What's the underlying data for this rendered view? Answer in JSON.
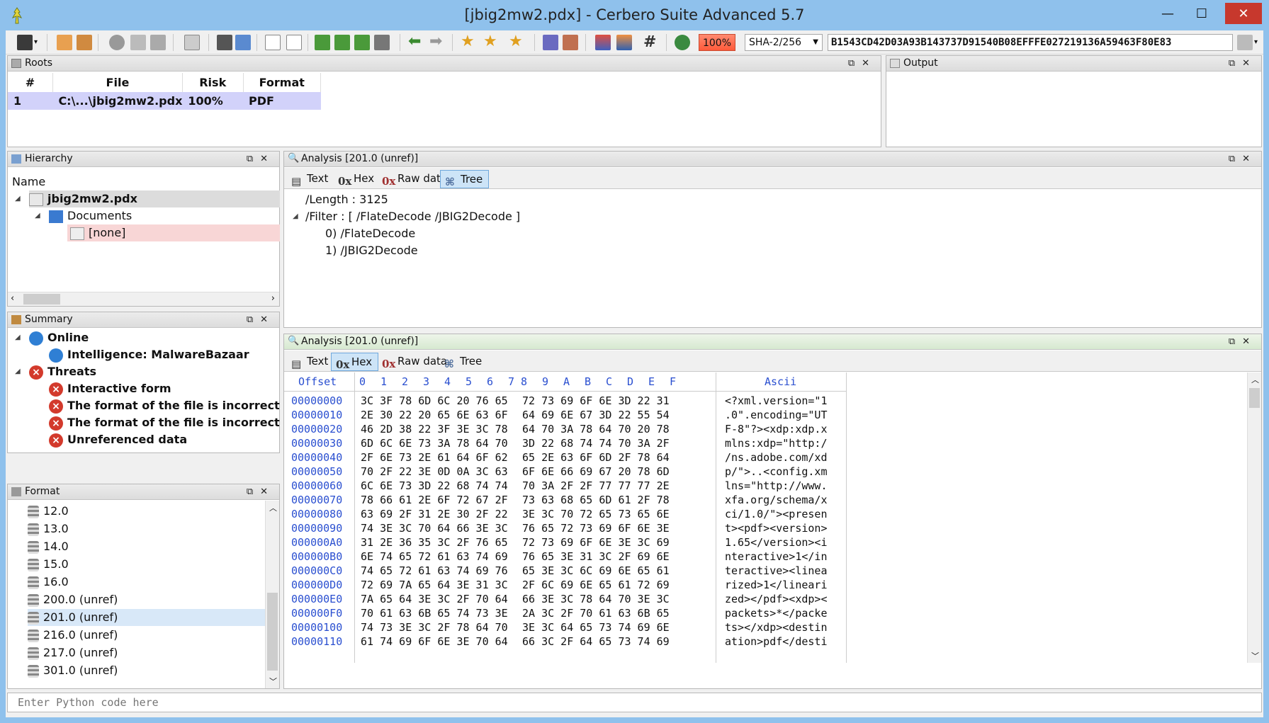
{
  "window": {
    "title": "[jbig2mw2.pdx] - Cerbero Suite Advanced 5.7",
    "minimize": "—",
    "maximize": "☐",
    "close": "✕"
  },
  "toolbar": {
    "risk_pct": "100%",
    "hash_algo": "SHA-2/256",
    "hash_value": "B1543CD42D03A93B143737D91540B08EFFFE027219136A59463F80E83"
  },
  "roots": {
    "title": "Roots",
    "columns": [
      "#",
      "File",
      "Risk",
      "Format"
    ],
    "row": {
      "num": "1",
      "file": "C:\\...\\jbig2mw2.pdx",
      "risk": "100%",
      "format": "PDF"
    }
  },
  "output": {
    "title": "Output"
  },
  "hierarchy": {
    "title": "Hierarchy",
    "col": "Name",
    "root": "jbig2mw2.pdx",
    "folder": "Documents",
    "leaf": "[none]"
  },
  "analysis_top": {
    "title": "Analysis [201.0 (unref)]",
    "tabs": [
      "Text",
      "Hex",
      "Raw data",
      "Tree"
    ],
    "tab_icons": [
      "",
      "0x",
      "0x",
      ""
    ],
    "lines": [
      "/Length : 3125",
      "/Filter : [ /FlateDecode /JBIG2Decode ]",
      "0) /FlateDecode",
      "1) /JBIG2Decode"
    ]
  },
  "summary": {
    "title": "Summary",
    "online": "Online",
    "intel": "Intelligence: MalwareBazaar",
    "threats": "Threats",
    "items": [
      "Interactive form",
      "The format of the file is incorrect",
      "The format of the file is incorrect",
      "Unreferenced data"
    ]
  },
  "format": {
    "title": "Format",
    "items": [
      "12.0",
      "13.0",
      "14.0",
      "15.0",
      "16.0",
      "200.0 (unref)",
      "201.0 (unref)",
      "216.0 (unref)",
      "217.0 (unref)",
      "301.0 (unref)"
    ]
  },
  "analysis_hex": {
    "title": "Analysis [201.0 (unref)]",
    "tabs": [
      "Text",
      "Hex",
      "Raw data",
      "Tree"
    ],
    "tab_icons": [
      "",
      "0x",
      "0x",
      ""
    ],
    "col_offset": "Offset",
    "col_ascii": "Ascii",
    "cols": [
      "0",
      "1",
      "2",
      "3",
      "4",
      "5",
      "6",
      "7",
      "8",
      "9",
      "A",
      "B",
      "C",
      "D",
      "E",
      "F"
    ],
    "rows": [
      {
        "off": "00000000",
        "a": "3C 3F 78 6D 6C 20 76 65",
        "b": "72 73 69 6F 6E 3D 22 31",
        "asc": "<?xml.version=\"1"
      },
      {
        "off": "00000010",
        "a": "2E 30 22 20 65 6E 63 6F",
        "b": "64 69 6E 67 3D 22 55 54",
        "asc": ".0\".encoding=\"UT"
      },
      {
        "off": "00000020",
        "a": "46 2D 38 22 3F 3E 3C 78",
        "b": "64 70 3A 78 64 70 20 78",
        "asc": "F-8\"?><xdp:xdp.x"
      },
      {
        "off": "00000030",
        "a": "6D 6C 6E 73 3A 78 64 70",
        "b": "3D 22 68 74 74 70 3A 2F",
        "asc": "mlns:xdp=\"http:/"
      },
      {
        "off": "00000040",
        "a": "2F 6E 73 2E 61 64 6F 62",
        "b": "65 2E 63 6F 6D 2F 78 64",
        "asc": "/ns.adobe.com/xd"
      },
      {
        "off": "00000050",
        "a": "70 2F 22 3E 0D 0A 3C 63",
        "b": "6F 6E 66 69 67 20 78 6D",
        "asc": "p/\">..<config.xm"
      },
      {
        "off": "00000060",
        "a": "6C 6E 73 3D 22 68 74 74",
        "b": "70 3A 2F 2F 77 77 77 2E",
        "asc": "lns=\"http://www."
      },
      {
        "off": "00000070",
        "a": "78 66 61 2E 6F 72 67 2F",
        "b": "73 63 68 65 6D 61 2F 78",
        "asc": "xfa.org/schema/x"
      },
      {
        "off": "00000080",
        "a": "63 69 2F 31 2E 30 2F 22",
        "b": "3E 3C 70 72 65 73 65 6E",
        "asc": "ci/1.0/\"><presen"
      },
      {
        "off": "00000090",
        "a": "74 3E 3C 70 64 66 3E 3C",
        "b": "76 65 72 73 69 6F 6E 3E",
        "asc": "t><pdf><version>"
      },
      {
        "off": "000000A0",
        "a": "31 2E 36 35 3C 2F 76 65",
        "b": "72 73 69 6F 6E 3E 3C 69",
        "asc": "1.65</version><i"
      },
      {
        "off": "000000B0",
        "a": "6E 74 65 72 61 63 74 69",
        "b": "76 65 3E 31 3C 2F 69 6E",
        "asc": "nteractive>1</in"
      },
      {
        "off": "000000C0",
        "a": "74 65 72 61 63 74 69 76",
        "b": "65 3E 3C 6C 69 6E 65 61",
        "asc": "teractive><linea"
      },
      {
        "off": "000000D0",
        "a": "72 69 7A 65 64 3E 31 3C",
        "b": "2F 6C 69 6E 65 61 72 69",
        "asc": "rized>1</lineari"
      },
      {
        "off": "000000E0",
        "a": "7A 65 64 3E 3C 2F 70 64",
        "b": "66 3E 3C 78 64 70 3E 3C",
        "asc": "zed></pdf><xdp><"
      },
      {
        "off": "000000F0",
        "a": "70 61 63 6B 65 74 73 3E",
        "b": "2A 3C 2F 70 61 63 6B 65",
        "asc": "packets>*</packe"
      },
      {
        "off": "00000100",
        "a": "74 73 3E 3C 2F 78 64 70",
        "b": "3E 3C 64 65 73 74 69 6E",
        "asc": "ts></xdp><destin"
      },
      {
        "off": "00000110",
        "a": "61 74 69 6F 6E 3E 70 64",
        "b": "66 3C 2F 64 65 73 74 69",
        "asc": "ation>pdf</desti"
      }
    ]
  },
  "python": {
    "placeholder": "Enter Python code here"
  },
  "colors": {
    "accent": "#8fc1ec",
    "selection": "#d2d2fa",
    "hex_blue": "#2a4fd0",
    "threat_red": "#d33a2c",
    "online_blue": "#2f7fd4"
  }
}
